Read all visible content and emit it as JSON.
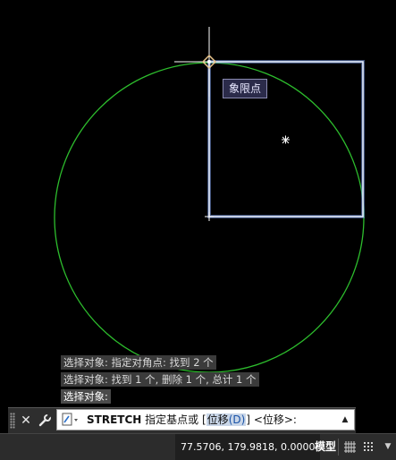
{
  "viewport": {
    "snap_tooltip": "象限点"
  },
  "history": [
    "选择对象: 指定对角点: 找到 2 个",
    "选择对象: 找到 1 个, 删除 1 个, 总计 1 个",
    "选择对象:"
  ],
  "command_line": {
    "command": "STRETCH",
    "prompt_text": "指定基点或",
    "bracket_open": "[",
    "option_label": "位移",
    "option_key": "(D)",
    "bracket_close": "]",
    "default_value": "<位移>:"
  },
  "status_bar": {
    "coordinates": "77.5706, 179.9818, 0.0000",
    "model_tab": "模型"
  },
  "colors": {
    "circle": "#2dbd2d",
    "selection_rect": "#cfe0ff",
    "crosshair": "#ffffff",
    "snap_marker": "#e8c38a"
  },
  "icons": {
    "close": "close-icon",
    "customize": "wrench-icon",
    "command_icon": "command-prompt-icon",
    "history_toggle": "chevron-up-icon",
    "grid": "grid-icon",
    "snap": "snap-icon",
    "menu": "chevron-down-icon"
  }
}
